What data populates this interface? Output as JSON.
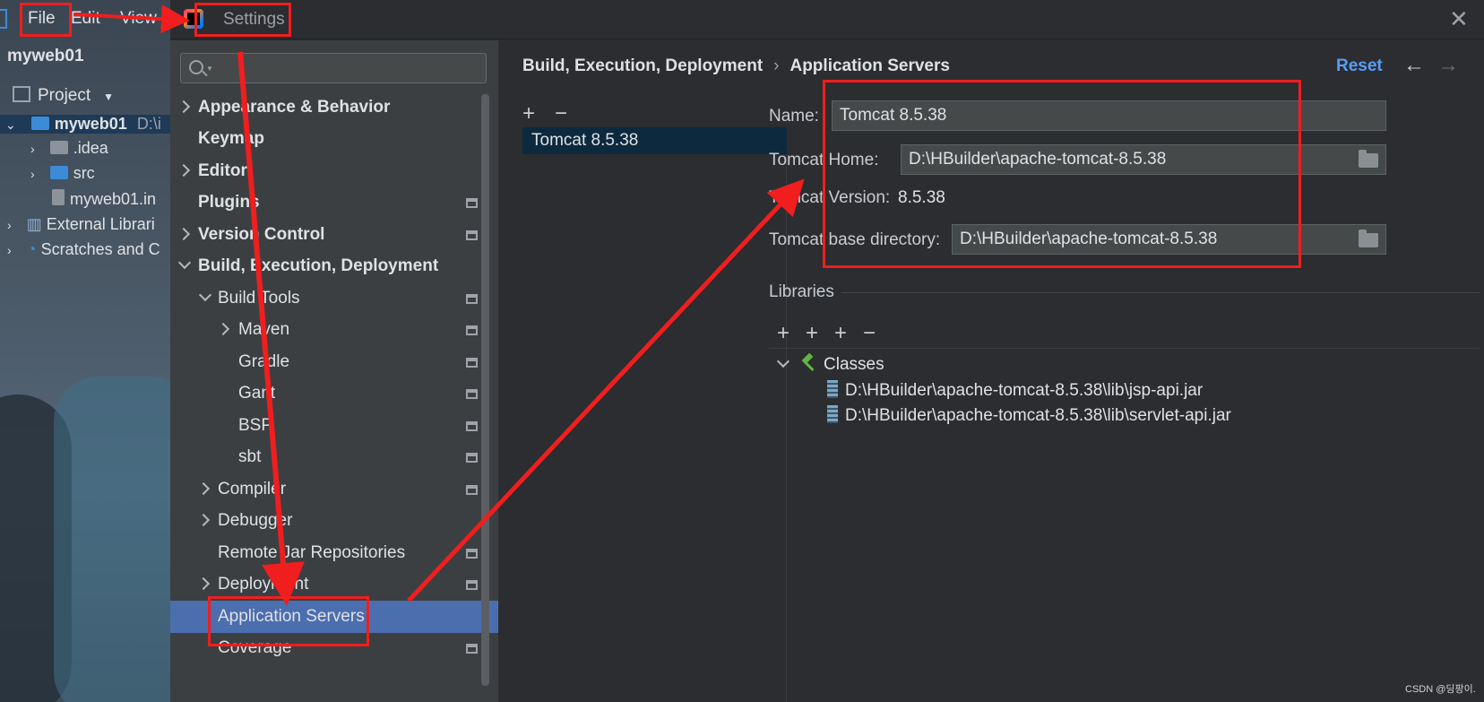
{
  "ide": {
    "menu": {
      "file": "File",
      "edit": "Edit",
      "view": "View"
    },
    "project_title": "myweb01",
    "project_tab": "Project",
    "tree": [
      {
        "label": "myweb01",
        "suffix": "D:\\i"
      },
      {
        "label": ".idea"
      },
      {
        "label": "src"
      },
      {
        "label": "myweb01.in"
      },
      {
        "label": "External Librari"
      },
      {
        "label": "Scratches and C"
      }
    ]
  },
  "dialog": {
    "title": "Settings",
    "close_icon": "close-icon"
  },
  "nav": {
    "search_placeholder": "",
    "items": [
      {
        "label": "Appearance & Behavior"
      },
      {
        "label": "Keymap"
      },
      {
        "label": "Editor"
      },
      {
        "label": "Plugins"
      },
      {
        "label": "Version Control"
      },
      {
        "label": "Build, Execution, Deployment"
      },
      {
        "label": "Build Tools"
      },
      {
        "label": "Maven"
      },
      {
        "label": "Gradle"
      },
      {
        "label": "Gant"
      },
      {
        "label": "BSP"
      },
      {
        "label": "sbt"
      },
      {
        "label": "Compiler"
      },
      {
        "label": "Debugger"
      },
      {
        "label": "Remote Jar Repositories"
      },
      {
        "label": "Deployment"
      },
      {
        "label": "Application Servers"
      },
      {
        "label": "Coverage"
      }
    ]
  },
  "content": {
    "breadcrumb": {
      "parent": "Build, Execution, Deployment",
      "current": "Application Servers"
    },
    "reset": "Reset",
    "servers": [
      "Tomcat 8.5.38"
    ],
    "form": {
      "name_label": "Name:",
      "name_value": "Tomcat 8.5.38",
      "home_label": "Tomcat Home:",
      "home_value": "D:\\HBuilder\\apache-tomcat-8.5.38",
      "version_label": "Tomcat Version:",
      "version_value": "8.5.38",
      "base_label": "Tomcat base directory:",
      "base_value": "D:\\HBuilder\\apache-tomcat-8.5.38"
    },
    "libraries": {
      "title": "Libraries",
      "group": "Classes",
      "jars": [
        "D:\\HBuilder\\apache-tomcat-8.5.38\\lib\\jsp-api.jar",
        "D:\\HBuilder\\apache-tomcat-8.5.38\\lib\\servlet-api.jar"
      ]
    }
  },
  "watermark": "CSDN @딩팡이.",
  "colors": {
    "selection": "#4b6eaf",
    "annotation_red": "#f01e1e",
    "reset_link": "#589df6"
  }
}
